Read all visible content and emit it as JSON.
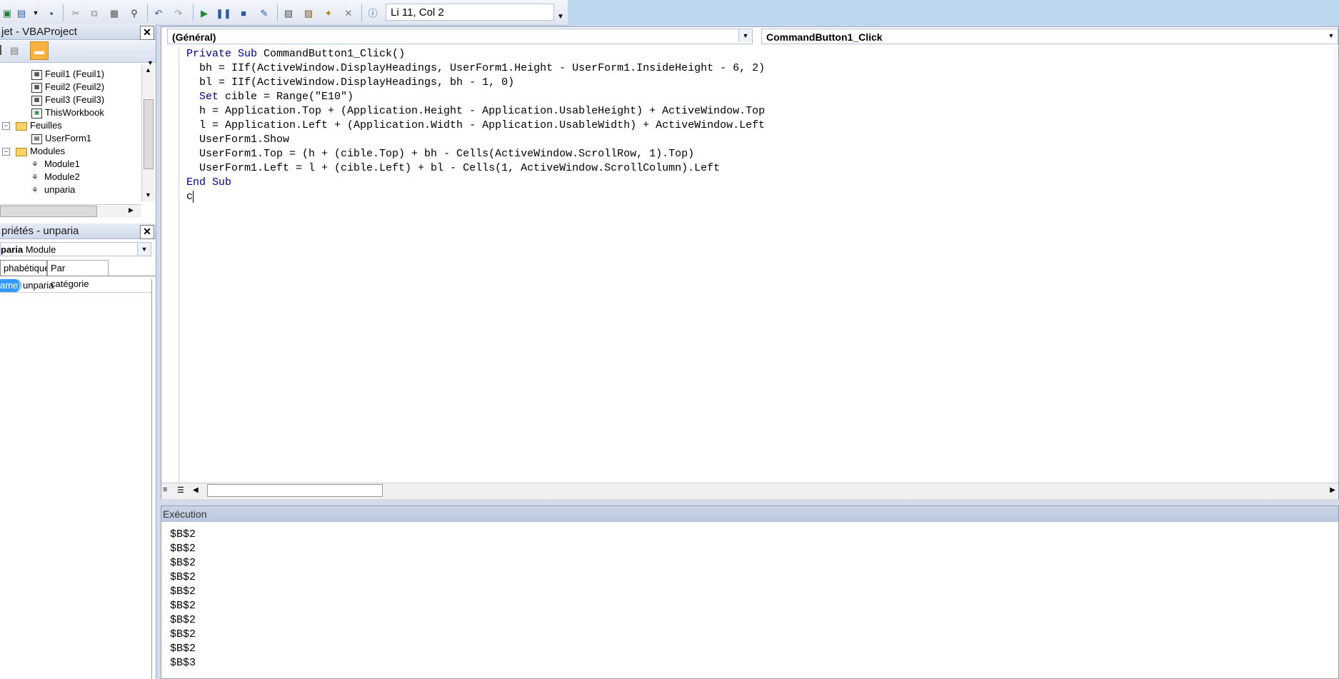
{
  "toolbar": {
    "position": "Li 11, Col 2",
    "icons": [
      "excel-icon",
      "insert-userform-icon",
      "dropdown-icon",
      "save-icon",
      "cut-icon",
      "copy-icon",
      "paste-icon",
      "find-icon",
      "undo-icon",
      "redo-icon",
      "run-icon",
      "break-icon",
      "reset-icon",
      "design-mode-icon",
      "project-explorer-icon",
      "properties-window-icon",
      "object-browser-icon",
      "toolbox-icon",
      "help-icon"
    ]
  },
  "project": {
    "title": "jet - VBAProject",
    "items": [
      {
        "label": "Feuil1 (Feuil1)",
        "icon": "sheet-icon"
      },
      {
        "label": "Feuil2 (Feuil2)",
        "icon": "sheet-icon"
      },
      {
        "label": "Feuil3 (Feuil3)",
        "icon": "sheet-icon"
      },
      {
        "label": "ThisWorkbook",
        "icon": "workbook-icon"
      },
      {
        "label": "Feuilles",
        "icon": "folder-icon"
      },
      {
        "label": "UserForm1",
        "icon": "form-icon"
      },
      {
        "label": "Modules",
        "icon": "folder-icon"
      },
      {
        "label": "Module1",
        "icon": "module-icon"
      },
      {
        "label": "Module2",
        "icon": "module-icon"
      },
      {
        "label": "unparia",
        "icon": "module-icon"
      }
    ]
  },
  "properties": {
    "title": "priétés - unparia",
    "object_name": "paria",
    "object_type": "Module",
    "tabs": [
      "phabétique",
      "Par catégorie"
    ],
    "row": {
      "name": "ame)",
      "value": "unparia"
    }
  },
  "code": {
    "object_combo": "(Général)",
    "proc_combo": "CommandButton1_Click",
    "lines": [
      {
        "kw": "Private Sub",
        "rest": " CommandButton1_Click()"
      },
      {
        "kw": "",
        "rest": "  bh = IIf(ActiveWindow.DisplayHeadings, UserForm1.Height - UserForm1.InsideHeight - 6, 2)"
      },
      {
        "kw": "",
        "rest": "  bl = IIf(ActiveWindow.DisplayHeadings, bh - 1, 0)"
      },
      {
        "kw": "  Set",
        "rest": " cible = Range(\"E10\")"
      },
      {
        "kw": "",
        "rest": "  h = Application.Top + (Application.Height - Application.UsableHeight) + ActiveWindow.Top"
      },
      {
        "kw": "",
        "rest": "  l = Application.Left + (Application.Width - Application.UsableWidth) + ActiveWindow.Left"
      },
      {
        "kw": "",
        "rest": "  UserForm1.Show"
      },
      {
        "kw": "",
        "rest": "  UserForm1.Top = (h + (cible.Top) + bh - Cells(ActiveWindow.ScrollRow, 1).Top)"
      },
      {
        "kw": "",
        "rest": "  UserForm1.Left = l + (cible.Left) + bl - Cells(1, ActiveWindow.ScrollColumn).Left"
      },
      {
        "kw": "End Sub",
        "rest": ""
      },
      {
        "kw": "",
        "rest": "c"
      }
    ]
  },
  "execution": {
    "title": "Exécution",
    "lines": [
      "$B$2",
      "$B$2",
      "$B$2",
      "$B$2",
      "$B$2",
      "$B$2",
      "$B$2",
      "$B$2",
      "$B$2",
      "$B$3"
    ]
  }
}
